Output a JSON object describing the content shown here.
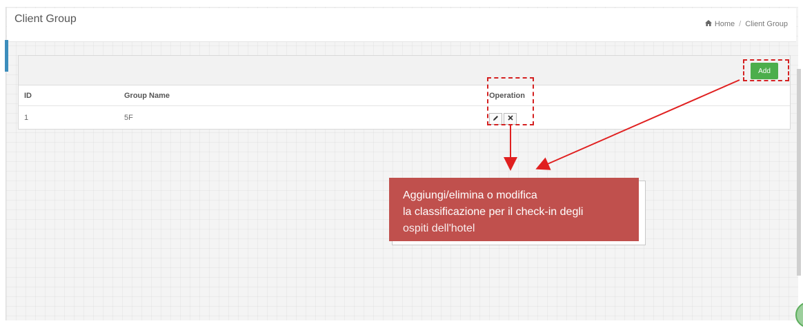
{
  "page": {
    "title": "Client Group",
    "breadcrumb": {
      "home": "Home",
      "current": "Client Group"
    }
  },
  "toolbar": {
    "add_label": "Add"
  },
  "table": {
    "headers": [
      "ID",
      "Group Name",
      "Operation"
    ],
    "rows": [
      {
        "id": "1",
        "group_name": "5F"
      }
    ]
  },
  "callout": {
    "line1": "Aggiungi/elimina o modifica",
    "line2": "la classificazione per il check-in degli",
    "line3": "ospiti dell'hotel"
  },
  "colors": {
    "accent": "#3c8dbc",
    "add_button": "#4cae4c",
    "annotation_red": "#d42020",
    "callout_bg": "#c0504d"
  },
  "icons": {
    "home": "home-icon",
    "edit": "pencil-icon",
    "delete": "close-icon"
  }
}
